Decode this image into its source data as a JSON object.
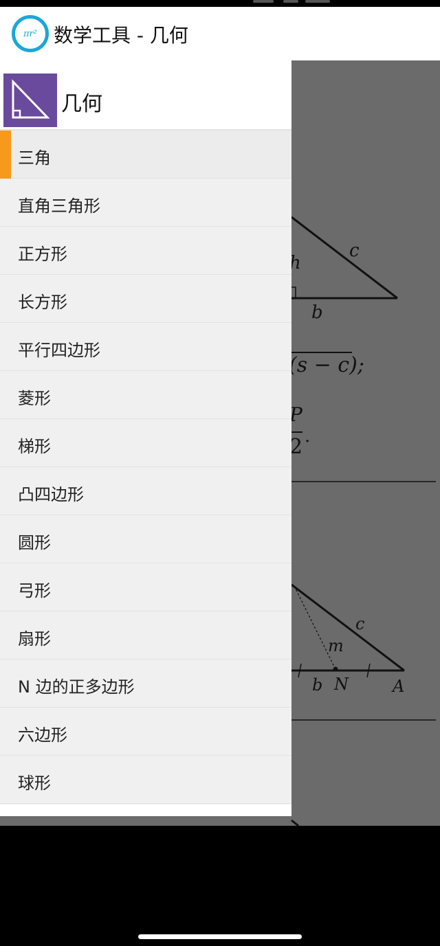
{
  "app_bar": {
    "logo_text": "πr²",
    "title": "数学工具 - 几何"
  },
  "drawer": {
    "header_title": "几何",
    "header_icon": "right-triangle-icon",
    "active_index": 0,
    "items": [
      {
        "label": "三角"
      },
      {
        "label": "直角三角形"
      },
      {
        "label": "正方形"
      },
      {
        "label": "长方形"
      },
      {
        "label": "平行四边形"
      },
      {
        "label": "菱形"
      },
      {
        "label": "梯形"
      },
      {
        "label": "凸四边形"
      },
      {
        "label": "圆形"
      },
      {
        "label": "弓形"
      },
      {
        "label": "扇形"
      },
      {
        "label": "N 边的正多边形"
      },
      {
        "label": "六边形"
      },
      {
        "label": "球形"
      }
    ]
  },
  "content_labels": {
    "h": "h",
    "c1": "c",
    "b1": "b",
    "formula1": "(s − c);",
    "p": "P",
    "two": "2",
    "dot": ".",
    "c2": "c",
    "m": "m",
    "b2": "b",
    "n": "N",
    "a": "A"
  },
  "colors": {
    "accent": "#f7991c",
    "header_icon_bg": "#6a4a9c",
    "logo": "#1aa7d6",
    "scrim": "#6b6b6b"
  }
}
